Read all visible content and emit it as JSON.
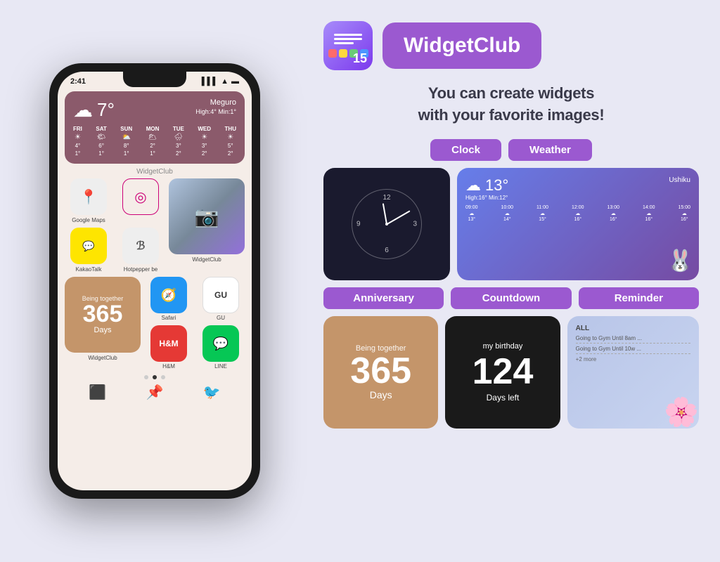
{
  "app": {
    "name": "WidgetClub",
    "tagline_line1": "You can create widgets",
    "tagline_line2": "with your favorite images!"
  },
  "phone": {
    "status_time": "2:41",
    "weather": {
      "temperature": "7°",
      "location": "Meguro",
      "high": "High:4°",
      "min": "Min:1°",
      "days": [
        {
          "name": "FRI",
          "icon": "☀",
          "high": "4°",
          "low": "1°"
        },
        {
          "name": "SAT",
          "icon": "🌤",
          "high": "6°",
          "low": "1°"
        },
        {
          "name": "SUN",
          "icon": "⛅",
          "high": "8°",
          "low": "1°"
        },
        {
          "name": "MON",
          "icon": "🌥",
          "high": "2°",
          "low": "1°"
        },
        {
          "name": "TUE",
          "icon": "🌧",
          "high": "3°",
          "low": "2°"
        },
        {
          "name": "WED",
          "icon": "☀",
          "high": "3°",
          "low": "2°"
        },
        {
          "name": "THU",
          "icon": "☀",
          "high": "5°",
          "low": "2°"
        }
      ]
    },
    "widgetclub_label": "WidgetClub",
    "apps": [
      {
        "name": "Google Maps",
        "icon": "📍"
      },
      {
        "name": "KakaoTalk"
      },
      {
        "name": "Hotpepper be"
      },
      {
        "name": "WidgetClub"
      }
    ],
    "anniversary": {
      "being_together": "Being together",
      "days": "365",
      "days_label": "Days"
    },
    "second_row": [
      {
        "name": "Safari"
      },
      {
        "name": "H&M"
      },
      {
        "name": "GU"
      },
      {
        "name": "LINE"
      }
    ]
  },
  "widget_types": [
    {
      "id": "clock",
      "label": "Clock"
    },
    {
      "id": "weather",
      "label": "Weather"
    },
    {
      "id": "anniversary",
      "label": "Anniversary"
    },
    {
      "id": "countdown",
      "label": "Countdown"
    },
    {
      "id": "reminder",
      "label": "Reminder"
    }
  ],
  "widgets": {
    "weather_preview": {
      "temp": "13°",
      "location": "Ushiku",
      "high": "High:16°",
      "min": "Min:12°",
      "times": [
        "09:00",
        "10:00",
        "11:00",
        "12:00",
        "13:00",
        "14:00",
        "15:00"
      ],
      "temps": [
        "13°",
        "14°",
        "15°",
        "16°",
        "16°",
        "16°",
        "16°"
      ]
    },
    "anniversary_preview": {
      "being_together": "Being together",
      "days": "365",
      "days_label": "Days"
    },
    "countdown_preview": {
      "title": "my birthday",
      "days": "124",
      "days_left": "Days left"
    },
    "reminder_preview": {
      "all_label": "ALL",
      "items": [
        "Going to Gym Until 8am ...",
        "Going to Gym Until 10w ..."
      ],
      "more": "+2 more"
    }
  }
}
